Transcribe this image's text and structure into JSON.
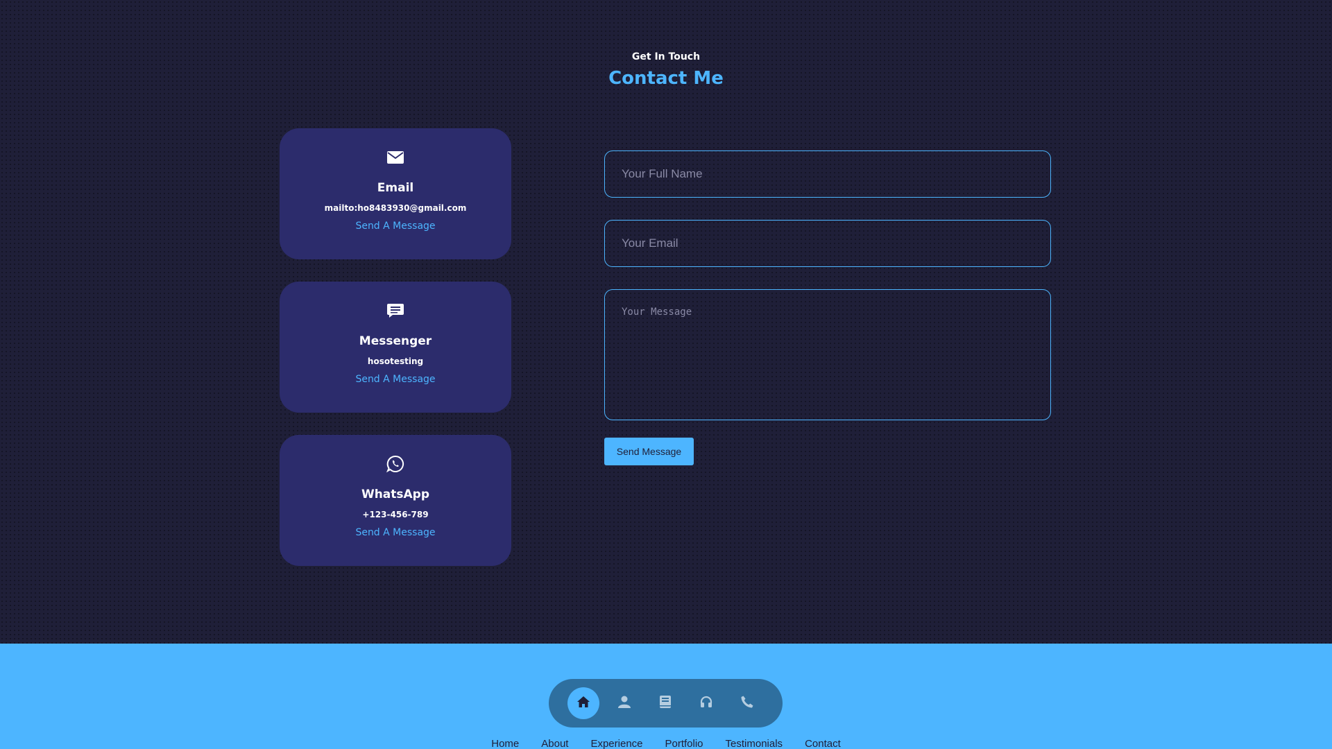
{
  "header": {
    "subtitle": "Get In Touch",
    "title": "Contact Me"
  },
  "contact_cards": [
    {
      "icon": "envelope-icon",
      "title": "Email",
      "value": "mailto:ho8483930@gmail.com",
      "link": "Send A Message"
    },
    {
      "icon": "message-icon",
      "title": "Messenger",
      "value": "hosotesting",
      "link": "Send A Message"
    },
    {
      "icon": "whatsapp-icon",
      "title": "WhatsApp",
      "value": "+123-456-789",
      "link": "Send A Message"
    }
  ],
  "form": {
    "name_placeholder": "Your Full Name",
    "email_placeholder": "Your Email",
    "message_placeholder": "Your Message",
    "submit_label": "Send Message"
  },
  "bottom_nav": {
    "items": [
      "home-icon",
      "user-icon",
      "book-icon",
      "headphones-icon",
      "phone-icon"
    ],
    "active": "home-icon"
  },
  "footer": {
    "links": [
      "Home",
      "About",
      "Experience",
      "Portfolio",
      "Testimonials",
      "Contact"
    ]
  },
  "colors": {
    "background": "#1f1f38",
    "card": "#2c2c6c",
    "accent": "#4db5ff"
  }
}
